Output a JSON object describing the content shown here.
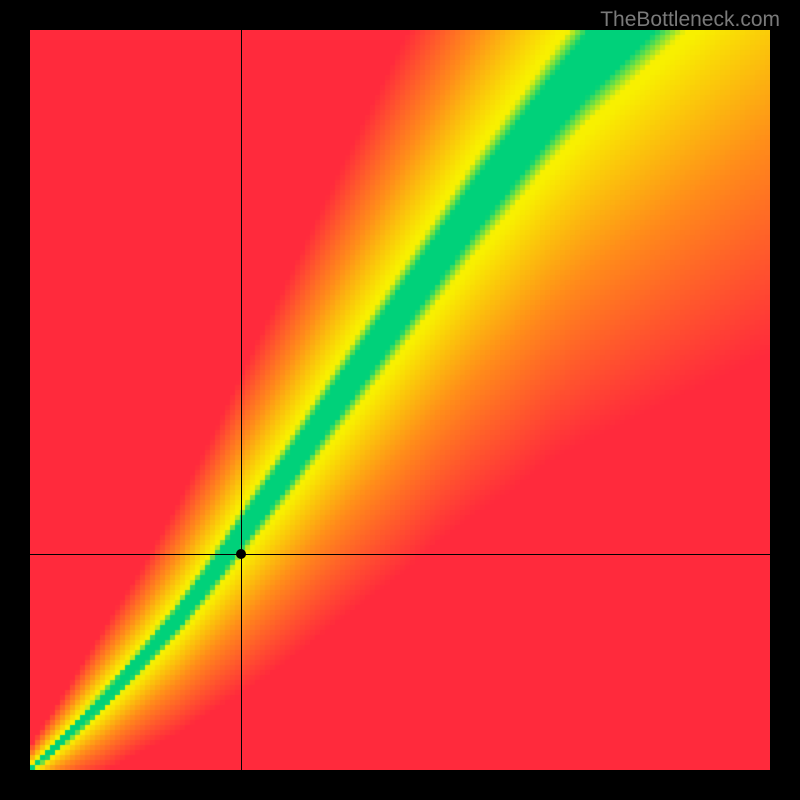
{
  "watermark": "TheBottleneck.com",
  "chart_data": {
    "type": "heatmap",
    "title": "",
    "xlabel": "",
    "ylabel": "",
    "xlim": [
      0,
      1
    ],
    "ylim": [
      0,
      1
    ],
    "crosshair": {
      "x": 0.285,
      "y": 0.292
    },
    "marker": {
      "x": 0.285,
      "y": 0.292
    },
    "optimal_curve": [
      {
        "x": 0.0,
        "y_center": 0.0,
        "half_width": 0.005
      },
      {
        "x": 0.05,
        "y_center": 0.045,
        "half_width": 0.01
      },
      {
        "x": 0.1,
        "y_center": 0.095,
        "half_width": 0.015
      },
      {
        "x": 0.15,
        "y_center": 0.148,
        "half_width": 0.019
      },
      {
        "x": 0.2,
        "y_center": 0.205,
        "half_width": 0.024
      },
      {
        "x": 0.25,
        "y_center": 0.27,
        "half_width": 0.029
      },
      {
        "x": 0.3,
        "y_center": 0.34,
        "half_width": 0.035
      },
      {
        "x": 0.35,
        "y_center": 0.408,
        "half_width": 0.04
      },
      {
        "x": 0.4,
        "y_center": 0.48,
        "half_width": 0.045
      },
      {
        "x": 0.45,
        "y_center": 0.55,
        "half_width": 0.05
      },
      {
        "x": 0.5,
        "y_center": 0.62,
        "half_width": 0.055
      },
      {
        "x": 0.55,
        "y_center": 0.69,
        "half_width": 0.059
      },
      {
        "x": 0.6,
        "y_center": 0.76,
        "half_width": 0.064
      },
      {
        "x": 0.65,
        "y_center": 0.825,
        "half_width": 0.069
      },
      {
        "x": 0.7,
        "y_center": 0.89,
        "half_width": 0.073
      },
      {
        "x": 0.75,
        "y_center": 0.95,
        "half_width": 0.078
      },
      {
        "x": 0.8,
        "y_center": 1.0,
        "half_width": 0.082
      }
    ],
    "colors": {
      "optimal": "#00d17a",
      "good": "#f8f000",
      "warm": "#ff8c1a",
      "bad": "#ff2a3c"
    },
    "grid": false,
    "legend": false
  },
  "plot": {
    "canvas_size": 740,
    "grid_resolution": 148
  }
}
